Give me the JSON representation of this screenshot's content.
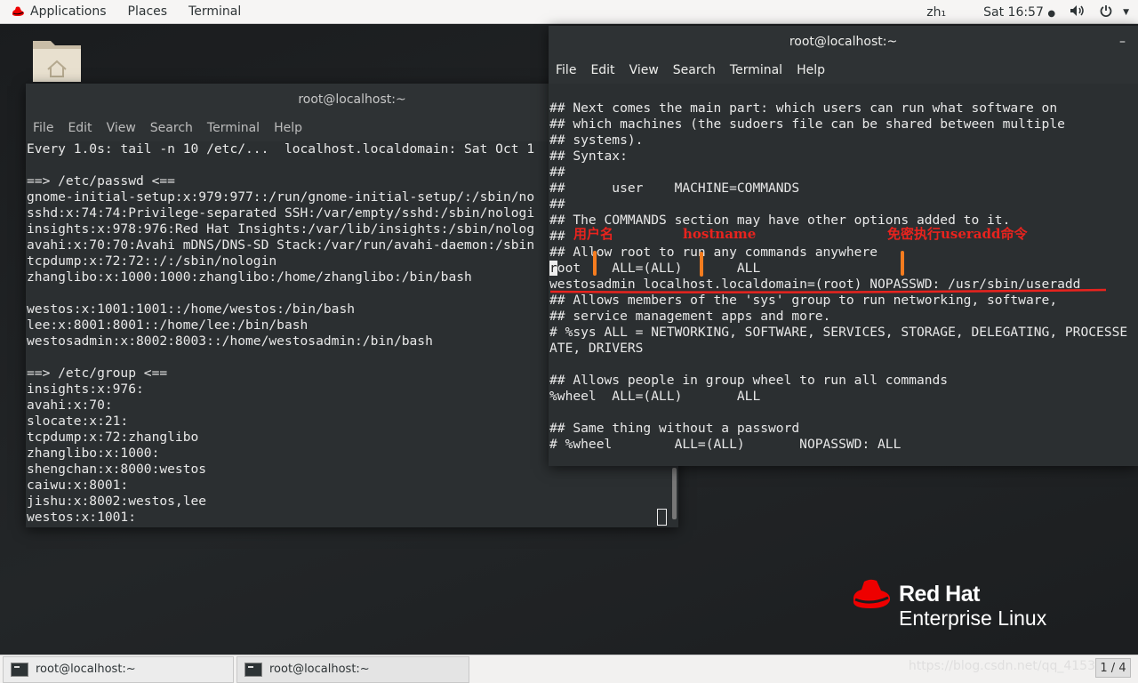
{
  "topbar": {
    "applications": "Applications",
    "places": "Places",
    "terminal": "Terminal",
    "input_method": "zh₁",
    "clock": "Sat 16:57",
    "dot": "●"
  },
  "left_window": {
    "title": "root@localhost:~",
    "menu": [
      "File",
      "Edit",
      "View",
      "Search",
      "Terminal",
      "Help"
    ],
    "lines": [
      "Every 1.0s: tail -n 10 /etc/...  localhost.localdomain: Sat Oct 1",
      "",
      "==> /etc/passwd <==",
      "gnome-initial-setup:x:979:977::/run/gnome-initial-setup/:/sbin/no",
      "sshd:x:74:74:Privilege-separated SSH:/var/empty/sshd:/sbin/nologi",
      "insights:x:978:976:Red Hat Insights:/var/lib/insights:/sbin/nolog",
      "avahi:x:70:70:Avahi mDNS/DNS-SD Stack:/var/run/avahi-daemon:/sbin",
      "tcpdump:x:72:72::/:/sbin/nologin",
      "zhanglibo:x:1000:1000:zhanglibo:/home/zhanglibo:/bin/bash",
      "",
      "westos:x:1001:1001::/home/westos:/bin/bash",
      "lee:x:8001:8001::/home/lee:/bin/bash",
      "westosadmin:x:8002:8003::/home/westosadmin:/bin/bash",
      "",
      "==> /etc/group <==",
      "insights:x:976:",
      "avahi:x:70:",
      "slocate:x:21:",
      "tcpdump:x:72:zhanglibo",
      "zhanglibo:x:1000:",
      "shengchan:x:8000:westos",
      "caiwu:x:8001:",
      "jishu:x:8002:westos,lee",
      "westos:x:1001:"
    ]
  },
  "right_window": {
    "title": "root@localhost:~",
    "minimize": "–",
    "menu": [
      "File",
      "Edit",
      "View",
      "Search",
      "Terminal",
      "Help"
    ],
    "lines": [
      "## Next comes the main part: which users can run what software on",
      "## which machines (the sudoers file can be shared between multiple",
      "## systems).",
      "## Syntax:",
      "##",
      "##      user    MACHINE=COMMANDS",
      "##",
      "## The COMMANDS section may have other options added to it.",
      "##",
      "## Allow root to run any commands anywhere",
      "oot    ALL=(ALL)       ALL",
      "westosadmin localhost.localdomain=(root) NOPASSWD: /usr/sbin/useradd",
      "## Allows members of the 'sys' group to run networking, software,",
      "## service management apps and more.",
      "# %sys ALL = NETWORKING, SOFTWARE, SERVICES, STORAGE, DELEGATING, PROCESSE",
      "ATE, DRIVERS",
      "",
      "## Allows people in group wheel to run all commands",
      "%wheel  ALL=(ALL)       ALL",
      "",
      "## Same thing without a password",
      "# %wheel        ALL=(ALL)       NOPASSWD: ALL"
    ],
    "cursor_char": "r"
  },
  "annotations": {
    "username": "用户名",
    "hostname": "hostname",
    "nopass": "免密执行useradd命令"
  },
  "brand": {
    "line1": "Red Hat",
    "line2": "Enterprise Linux"
  },
  "taskbar": {
    "task1": "root@localhost:~",
    "task2": "root@localhost:~",
    "watermark": "https://blog.csdn.net/qq_4153",
    "workspace": "1 / 4"
  },
  "colors": {
    "annotation_red": "#e8231e",
    "annotation_orange": "#f57c1f",
    "redhat_red": "#ee0000"
  }
}
